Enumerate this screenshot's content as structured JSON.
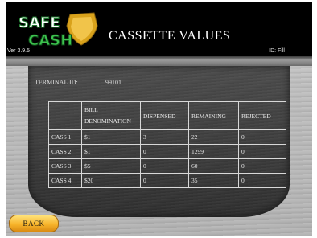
{
  "header": {
    "logo_text_top": "SAFE",
    "logo_text_bottom": "CASH",
    "title": "CASSETTE VALUES",
    "version": "Ver 3.9.5",
    "id_label": "ID: Fill"
  },
  "terminal": {
    "label": "TERMINAL ID:",
    "value": "99101"
  },
  "table": {
    "headers": [
      "",
      "BILL DENOMINATION",
      "DISPENSED",
      "REMAINING",
      "REJECTED"
    ],
    "rows": [
      [
        "CASS 1",
        "$1",
        "3",
        "22",
        "0"
      ],
      [
        "CASS 2",
        "$1",
        "0",
        "1299",
        "0"
      ],
      [
        "CASS 3",
        "$5",
        "0",
        "60",
        "0"
      ],
      [
        "CASS 4",
        "$20",
        "0",
        "35",
        "0"
      ]
    ]
  },
  "buttons": {
    "back_label": "BACK"
  },
  "colors": {
    "header_bg": "#000000",
    "logo_green": "#2fb34a",
    "logo_gold": "#e0b020",
    "button_gold": "#f7b42a"
  }
}
